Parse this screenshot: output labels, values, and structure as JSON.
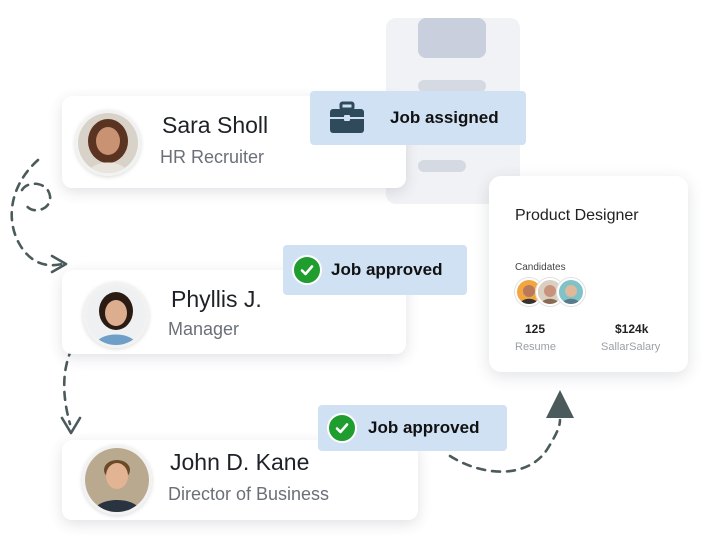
{
  "people": [
    {
      "name": "Sara Sholl",
      "role": "HR Recruiter"
    },
    {
      "name": "Phyllis J.",
      "role": "Manager"
    },
    {
      "name": "John D. Kane",
      "role": "Director of Business"
    }
  ],
  "badges": {
    "assigned": {
      "label": "Job assigned",
      "icon": "briefcase-icon"
    },
    "approved_1": {
      "label": "Job approved",
      "icon": "check-circle-icon"
    },
    "approved_2": {
      "label": "Job approved",
      "icon": "check-circle-icon"
    }
  },
  "job_card": {
    "title": "Product Designer",
    "candidates_label": "Candidates",
    "stats": [
      {
        "value": "125",
        "label": "Resume"
      },
      {
        "value": "$124k",
        "label": "SallarSalary"
      }
    ]
  },
  "colors": {
    "badge_bg": "#cfe1f3",
    "check_green": "#1f9d2e",
    "arrow": "#4b5a5a",
    "briefcase": "#2f4a5a"
  }
}
